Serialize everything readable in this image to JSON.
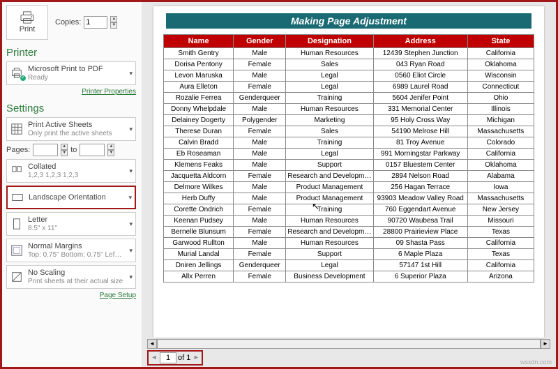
{
  "print": {
    "label": "Print",
    "copies_label": "Copies:",
    "copies_value": "1"
  },
  "printer": {
    "heading": "Printer",
    "name": "Microsoft Print to PDF",
    "status": "Ready",
    "props_link": "Printer Properties"
  },
  "settings": {
    "heading": "Settings",
    "active_sheets": {
      "main": "Print Active Sheets",
      "sub": "Only print the active sheets"
    },
    "pages_label": "Pages:",
    "pages_to": "to",
    "collated": {
      "main": "Collated",
      "sub": "1,2,3   1,2,3   1,2,3"
    },
    "orientation": {
      "main": "Landscape Orientation"
    },
    "paper": {
      "main": "Letter",
      "sub": "8.5\" x 11\""
    },
    "margins": {
      "main": "Normal Margins",
      "sub": "Top: 0.75\" Bottom: 0.75\" Lef…"
    },
    "scaling": {
      "main": "No Scaling",
      "sub": "Print sheets at their actual size"
    },
    "page_setup_link": "Page Setup"
  },
  "document": {
    "title": "Making Page Adjustment",
    "headers": [
      "Name",
      "Gender",
      "Designation",
      "Address",
      "State"
    ],
    "rows": [
      [
        "Smith Gentry",
        "Male",
        "Human Resources",
        "12439 Stephen Junction",
        "California"
      ],
      [
        "Dorisa Pentony",
        "Female",
        "Sales",
        "043 Ryan Road",
        "Oklahoma"
      ],
      [
        "Levon Maruska",
        "Male",
        "Legal",
        "0560 Eliot Circle",
        "Wisconsin"
      ],
      [
        "Aura Elleton",
        "Female",
        "Legal",
        "6989 Laurel Road",
        "Connecticut"
      ],
      [
        "Rozalie Ferrea",
        "Genderqueer",
        "Training",
        "5604 Jenifer Point",
        "Ohio"
      ],
      [
        "Donny Whelpdale",
        "Male",
        "Human Resources",
        "331 Memorial Center",
        "Illinois"
      ],
      [
        "Delainey Dogerty",
        "Polygender",
        "Marketing",
        "95 Holy Cross Way",
        "Michigan"
      ],
      [
        "Therese Duran",
        "Female",
        "Sales",
        "54190 Melrose Hill",
        "Massachusetts"
      ],
      [
        "Calvin Bradd",
        "Male",
        "Training",
        "81 Troy Avenue",
        "Colorado"
      ],
      [
        "Eb Roseaman",
        "Male",
        "Legal",
        "991 Morningstar Parkway",
        "California"
      ],
      [
        "Klemens Feaks",
        "Male",
        "Support",
        "0157 Bluestem Center",
        "Oklahoma"
      ],
      [
        "Jacquetta Aldcorn",
        "Female",
        "Research and Development",
        "2894 Nelson Road",
        "Alabama"
      ],
      [
        "Delmore Wilkes",
        "Male",
        "Product Management",
        "256 Hagan Terrace",
        "Iowa"
      ],
      [
        "Herb Duffy",
        "Male",
        "Product Management",
        "93903 Meadow Valley Road",
        "Massachusetts"
      ],
      [
        "Corette Ondrich",
        "Female",
        "Training",
        "760 Eggendart Avenue",
        "New Jersey"
      ],
      [
        "Keenan Pudsey",
        "Male",
        "Human Resources",
        "90720 Waubesa Trail",
        "Missouri"
      ],
      [
        "Bernelle Blunsum",
        "Female",
        "Research and Development",
        "28800 Prairieview Place",
        "Texas"
      ],
      [
        "Garwood Rullton",
        "Male",
        "Human Resources",
        "09 Shasta Pass",
        "California"
      ],
      [
        "Murial Landal",
        "Female",
        "Support",
        "6 Maple Plaza",
        "Texas"
      ],
      [
        "Dniren Jellings",
        "Genderqueer",
        "Legal",
        "57147 1st Hill",
        "California"
      ],
      [
        "Allx Perren",
        "Female",
        "Business Development",
        "6 Superior Plaza",
        "Arizona"
      ]
    ]
  },
  "pager": {
    "current": "1",
    "of_label": "of 1"
  },
  "watermark": "wsxdn.com"
}
